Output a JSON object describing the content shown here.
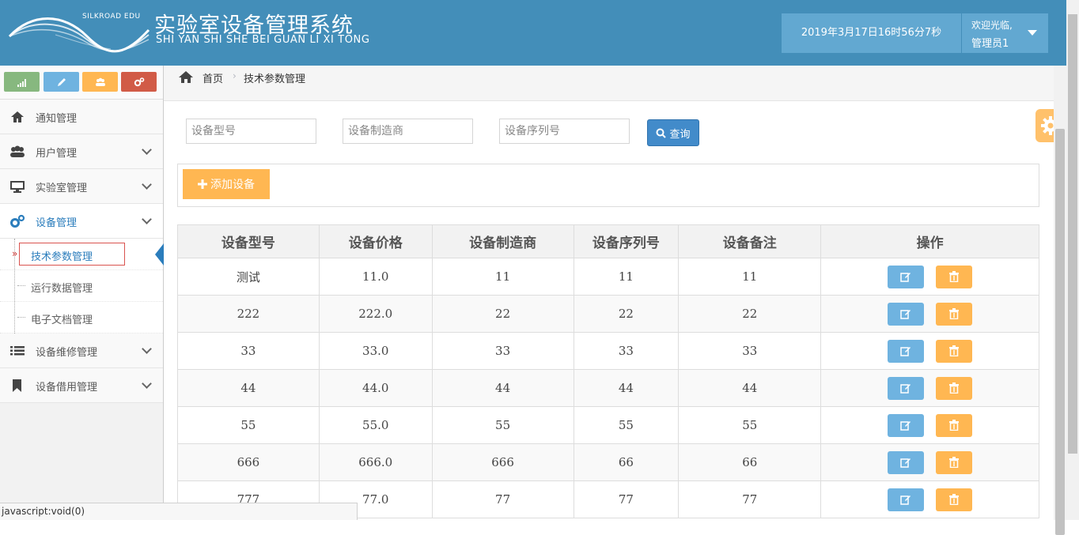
{
  "header": {
    "logo_tag": "SILKROAD EDU",
    "title": "实验室设备管理系统",
    "subtitle": "SHI YAN SHI SHE BEI GUAN LI XI TONG",
    "datetime": "2019年3月17日16时56分7秒",
    "welcome": "欢迎光临,",
    "username": "管理员1"
  },
  "colors": {
    "header_bg": "#438eb9",
    "accent_blue": "#428bca",
    "warning_orange": "#ffb752",
    "success_green": "#87b87f",
    "info_blue": "#6fb3e0",
    "danger_red": "#d15b47"
  },
  "sidebar": {
    "shortcuts": [
      {
        "icon": "signal-icon",
        "color": "#87b87f"
      },
      {
        "icon": "pencil-icon",
        "color": "#6fb3e0"
      },
      {
        "icon": "users-icon",
        "color": "#ffb752"
      },
      {
        "icon": "cogs-icon",
        "color": "#d15b47"
      }
    ],
    "items": [
      {
        "label": "通知管理",
        "icon": "home-icon"
      },
      {
        "label": "用户管理",
        "icon": "users-icon"
      },
      {
        "label": "实验室管理",
        "icon": "desktop-icon"
      },
      {
        "label": "设备管理",
        "icon": "cogs-icon"
      },
      {
        "label": "设备维修管理",
        "icon": "list-icon"
      },
      {
        "label": "设备借用管理",
        "icon": "bookmark-icon"
      }
    ],
    "submenu": [
      {
        "label": "技术参数管理"
      },
      {
        "label": "运行数据管理"
      },
      {
        "label": "电子文档管理"
      }
    ]
  },
  "breadcrumb": {
    "home": "首页",
    "current": "技术参数管理"
  },
  "search": {
    "model_placeholder": "设备型号",
    "maker_placeholder": "设备制造商",
    "serial_placeholder": "设备序列号",
    "button": "查询"
  },
  "toolbar": {
    "add_label": "添加设备"
  },
  "table": {
    "headers": [
      "设备型号",
      "设备价格",
      "设备制造商",
      "设备序列号",
      "设备备注",
      "操作"
    ],
    "rows": [
      [
        "测试",
        "11.0",
        "11",
        "11",
        "11"
      ],
      [
        "222",
        "222.0",
        "22",
        "22",
        "22"
      ],
      [
        "33",
        "33.0",
        "33",
        "33",
        "33"
      ],
      [
        "44",
        "44.0",
        "44",
        "44",
        "44"
      ],
      [
        "55",
        "55.0",
        "55",
        "55",
        "55"
      ],
      [
        "666",
        "666.0",
        "666",
        "66",
        "66"
      ],
      [
        "777",
        "77.0",
        "77",
        "77",
        "77"
      ]
    ]
  },
  "statusbar": "javascript:void(0)"
}
